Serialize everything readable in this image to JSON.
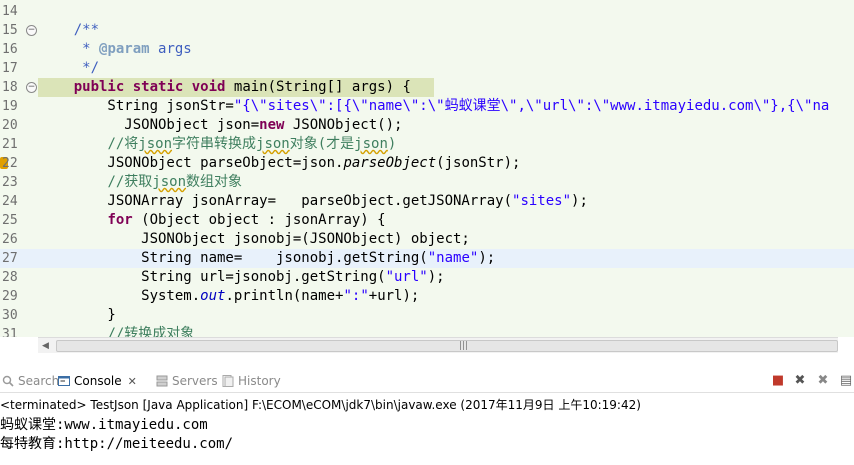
{
  "editor": {
    "lines": [
      {
        "num": "14",
        "segs": []
      },
      {
        "num": "15",
        "fold": "−",
        "segs": [
          {
            "t": "    "
          },
          {
            "t": "/**",
            "c": "doc"
          }
        ]
      },
      {
        "num": "16",
        "segs": [
          {
            "t": "     "
          },
          {
            "t": "* ",
            "c": "doc"
          },
          {
            "t": "@param",
            "c": "tag"
          },
          {
            "t": " args",
            "c": "doc"
          }
        ]
      },
      {
        "num": "17",
        "segs": [
          {
            "t": "     "
          },
          {
            "t": "*/",
            "c": "doc"
          }
        ]
      },
      {
        "num": "18",
        "fold": "−",
        "sig": true,
        "segs": [
          {
            "t": "    "
          },
          {
            "t": "public",
            "c": "kw"
          },
          {
            "t": " "
          },
          {
            "t": "static",
            "c": "kw"
          },
          {
            "t": " "
          },
          {
            "t": "void",
            "c": "kw"
          },
          {
            "t": " main(String[] args) {"
          }
        ]
      },
      {
        "num": "19",
        "segs": [
          {
            "t": "        String jsonStr="
          },
          {
            "t": "\"{\\\"sites\\\":[{\\\"name\\\":\\\"蚂蚁课堂\\\",\\\"url\\\":\\\"www.itmayiedu.com\\\"},{\\\"na",
            "c": "str"
          }
        ]
      },
      {
        "num": "20",
        "segs": [
          {
            "t": "          JSONObject json="
          },
          {
            "t": "new",
            "c": "kw"
          },
          {
            "t": " JSONObject();"
          }
        ]
      },
      {
        "num": "21",
        "segs": [
          {
            "t": "        "
          },
          {
            "t": "//将",
            "c": "cmt"
          },
          {
            "t": "json",
            "c": "cmt wavy"
          },
          {
            "t": "字符串转换成",
            "c": "cmt"
          },
          {
            "t": "json",
            "c": "cmt wavy"
          },
          {
            "t": "对象(才是",
            "c": "cmt"
          },
          {
            "t": "json",
            "c": "cmt wavy"
          },
          {
            "t": ")",
            "c": "cmt"
          }
        ]
      },
      {
        "num": "22",
        "marker": true,
        "segs": [
          {
            "t": "        JSONObject parseObject=json."
          },
          {
            "t": "parseObject",
            "c": "it"
          },
          {
            "t": "(jsonStr);"
          }
        ]
      },
      {
        "num": "23",
        "segs": [
          {
            "t": "        "
          },
          {
            "t": "//获取",
            "c": "cmt"
          },
          {
            "t": "json",
            "c": "cmt wavy"
          },
          {
            "t": "数组对象",
            "c": "cmt"
          }
        ]
      },
      {
        "num": "24",
        "segs": [
          {
            "t": "        JSONArray jsonArray=   parseObject.getJSONArray("
          },
          {
            "t": "\"sites\"",
            "c": "str"
          },
          {
            "t": ");"
          }
        ]
      },
      {
        "num": "25",
        "segs": [
          {
            "t": "        "
          },
          {
            "t": "for",
            "c": "kw"
          },
          {
            "t": " (Object object : jsonArray) {"
          }
        ]
      },
      {
        "num": "26",
        "segs": [
          {
            "t": "            JSONObject jsonobj=(JSONObject) object;"
          }
        ]
      },
      {
        "num": "27",
        "hl": true,
        "segs": [
          {
            "t": "            String name=    jsonobj.getString("
          },
          {
            "t": "\"name\"",
            "c": "str"
          },
          {
            "t": ");"
          }
        ]
      },
      {
        "num": "28",
        "segs": [
          {
            "t": "            String url=jsonobj.getString("
          },
          {
            "t": "\"url\"",
            "c": "str"
          },
          {
            "t": ");"
          }
        ]
      },
      {
        "num": "29",
        "segs": [
          {
            "t": "            System."
          },
          {
            "t": "out",
            "c": "fld"
          },
          {
            "t": ".println(name+"
          },
          {
            "t": "\":\"",
            "c": "str"
          },
          {
            "t": "+url);"
          }
        ]
      },
      {
        "num": "30",
        "segs": [
          {
            "t": "        }"
          }
        ]
      },
      {
        "num": "31",
        "segs": [
          {
            "t": "        "
          },
          {
            "t": "//转换成对象",
            "c": "cmt"
          }
        ]
      }
    ]
  },
  "scrollbar": {
    "grip": "|||"
  },
  "tabs": [
    {
      "label": "Search",
      "icon": "search-icon",
      "active": false
    },
    {
      "label": "Console",
      "icon": "console-icon",
      "active": true,
      "close": "✕"
    },
    {
      "label": "Servers",
      "icon": "servers-icon",
      "active": false
    },
    {
      "label": "History",
      "icon": "history-icon",
      "active": false
    }
  ],
  "toolbar": [
    {
      "icon": "terminate-icon",
      "glyph": "■"
    },
    {
      "icon": "remove-launch-icon",
      "glyph": "✖"
    },
    {
      "icon": "remove-all-terminated-icon",
      "glyph": "✖"
    },
    {
      "icon": "clear-console-icon",
      "glyph": "▤"
    }
  ],
  "console": {
    "header": "<terminated> TestJson [Java Application] F:\\ECOM\\eCOM\\jdk7\\bin\\javaw.exe (2017年11月9日 上午10:19:42)",
    "output": [
      "蚂蚁课堂:www.itmayiedu.com",
      "每特教育:http://meiteedu.com/"
    ]
  },
  "colors": {
    "editor_bg": "#f3f9ee",
    "keyword": "#7f0055",
    "string": "#2a00ff",
    "comment": "#3f7f5f",
    "javadoc": "#3f5fbf",
    "current_line": "#e8f1fb",
    "method_sig": "#dbe4b8"
  }
}
